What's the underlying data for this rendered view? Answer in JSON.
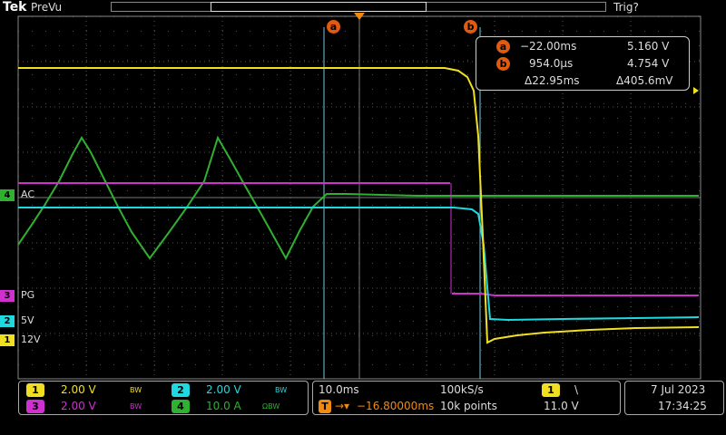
{
  "header": {
    "brand": "Tek",
    "mode": "PreVu",
    "trigger_status": "Trig?"
  },
  "cursors": {
    "a_label": "a",
    "b_label": "b",
    "a_time": "−22.00ms",
    "a_value": "5.160 V",
    "b_time": "954.0μs",
    "b_value": "4.754 V",
    "delta_time": "Δ22.95ms",
    "delta_value": "Δ405.6mV"
  },
  "channel_labels": {
    "ch4": {
      "num": "4",
      "label": "AC"
    },
    "ch3": {
      "num": "3",
      "label": "PG"
    },
    "ch2": {
      "num": "2",
      "label": "5V"
    },
    "ch1": {
      "num": "1",
      "label": "12V"
    }
  },
  "colors": {
    "ch1": "#f0e020",
    "ch2": "#20d8e0",
    "ch3": "#d030d0",
    "ch4": "#30b030",
    "cursor": "#e05a10",
    "grid": "#5a5a5a"
  },
  "vertical": {
    "ch1": {
      "num": "1",
      "scale": "2.00 V",
      "bw": "BW"
    },
    "ch2": {
      "num": "2",
      "scale": "2.00 V",
      "bw": "BW"
    },
    "ch3": {
      "num": "3",
      "scale": "2.00 V",
      "bw": "BW"
    },
    "ch4": {
      "num": "4",
      "scale": "10.0 A",
      "bw": "ΩBW"
    }
  },
  "horizontal": {
    "time_per_div": "10.0ms",
    "sample_rate": "100kS/s",
    "trigger_delay": "−16.80000ms",
    "record_length": "10k points"
  },
  "trigger": {
    "source": "1",
    "slope": "\\",
    "level": "11.0 V"
  },
  "datetime": {
    "date": "7 Jul  2023",
    "time": "17:34:25"
  }
}
